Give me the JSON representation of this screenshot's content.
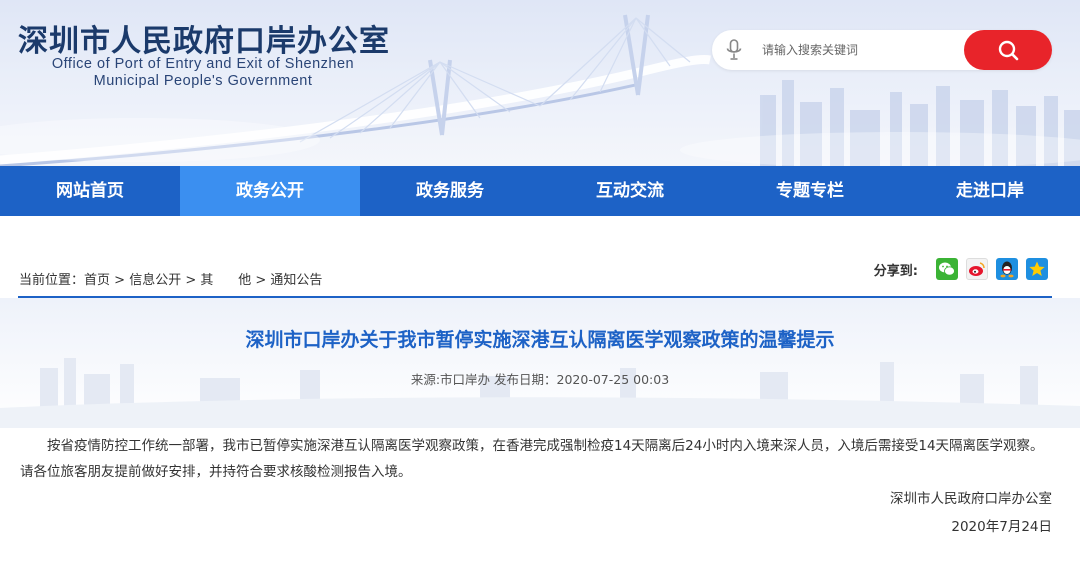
{
  "header": {
    "org_name_cn": "深圳市人民政府口岸办公室",
    "org_name_en_line1": "Office of Port of Entry and Exit of Shenzhen",
    "org_name_en_line2": "Municipal People's Government",
    "search": {
      "placeholder": "请输入搜索关键词",
      "mic_icon": "microphone-icon",
      "search_icon": "magnifier-icon"
    }
  },
  "nav": {
    "items": [
      {
        "label": "网站首页"
      },
      {
        "label": "政务公开"
      },
      {
        "label": "政务服务"
      },
      {
        "label": "互动交流"
      },
      {
        "label": "专题专栏"
      },
      {
        "label": "走进口岸"
      }
    ],
    "active_index": 1
  },
  "breadcrumb": {
    "prefix": "当前位置：",
    "items": [
      "首页",
      "信息公开",
      "其      他",
      "通知公告"
    ],
    "separator": ">"
  },
  "share": {
    "label": "分享到:",
    "icons": [
      "wechat-icon",
      "weibo-icon",
      "qq-icon",
      "qzone-icon"
    ]
  },
  "article": {
    "title": "深圳市口岸办关于我市暂停实施深港互认隔离医学观察政策的温馨提示",
    "meta": "来源:市口岸办 发布日期：2020-07-25 00:03",
    "body": "按省疫情防控工作统一部署，我市已暂停实施深港互认隔离医学观察政策，在香港完成强制检疫14天隔离后24小时内入境来深人员，入境后需接受14天隔离医学观察。请各位旅客朋友提前做好安排，并持符合要求核酸检测报告入境。",
    "signature_org": "深圳市人民政府口岸办公室",
    "signature_date": "2020年7月24日"
  },
  "colors": {
    "nav_bg": "#1d62c6",
    "nav_active": "#3b8ff0",
    "title": "#1d62c6",
    "search_button": "#e8242a",
    "header_text": "#1b3a6b"
  }
}
